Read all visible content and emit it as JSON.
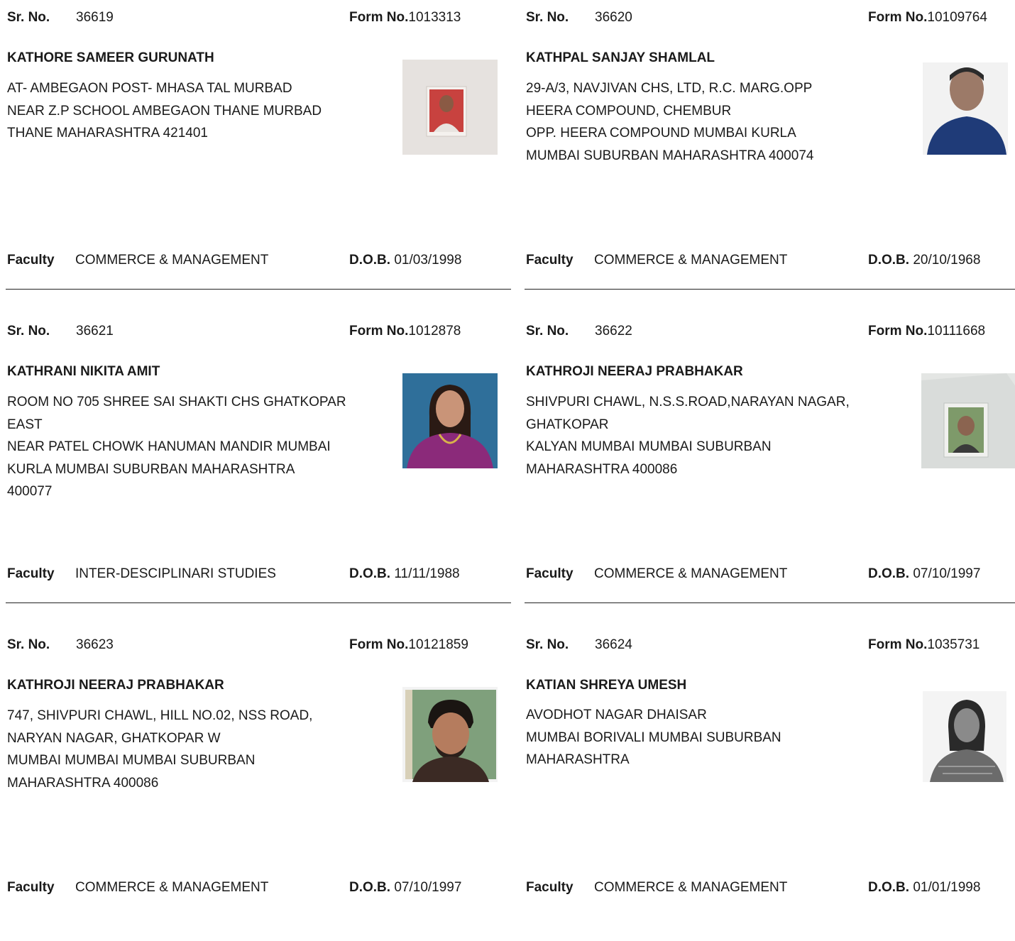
{
  "labels": {
    "sr_no": "Sr. No.",
    "form_no": "Form No.",
    "faculty": "Faculty",
    "dob": "D.O.B."
  },
  "records": [
    {
      "sr_no": "36619",
      "form_no": "1013313",
      "name": "KATHORE SAMEER GURUNATH",
      "address": [
        "AT- AMBEGAON POST- MHASA TAL MURBAD",
        "NEAR Z.P SCHOOL AMBEGAON THANE MURBAD",
        "THANE MAHARASHTRA 421401"
      ],
      "faculty": "COMMERCE & MANAGEMENT",
      "dob": "01/03/1998"
    },
    {
      "sr_no": "36620",
      "form_no": "10109764",
      "name": "KATHPAL SANJAY SHAMLAL",
      "address": [
        "29-A/3, NAVJIVAN CHS, LTD, R.C. MARG.OPP",
        "HEERA COMPOUND, CHEMBUR",
        "OPP. HEERA COMPOUND MUMBAI KURLA",
        "MUMBAI SUBURBAN MAHARASHTRA 400074"
      ],
      "faculty": "COMMERCE & MANAGEMENT",
      "dob": "20/10/1968"
    },
    {
      "sr_no": "36621",
      "form_no": "1012878",
      "name": "KATHRANI NIKITA AMIT",
      "address": [
        "ROOM NO 705 SHREE SAI SHAKTI CHS GHATKOPAR",
        "EAST",
        "NEAR PATEL CHOWK HANUMAN MANDIR MUMBAI",
        "KURLA MUMBAI SUBURBAN MAHARASHTRA",
        "400077"
      ],
      "faculty": "INTER-DESCIPLINARI STUDIES",
      "dob": "11/11/1988"
    },
    {
      "sr_no": "36622",
      "form_no": "10111668",
      "name": "KATHROJI NEERAJ PRABHAKAR",
      "address": [
        "SHIVPURI CHAWL, N.S.S.ROAD,NARAYAN NAGAR,",
        "GHATKOPAR",
        " KALYAN MUMBAI MUMBAI SUBURBAN",
        "MAHARASHTRA 400086"
      ],
      "faculty": "COMMERCE & MANAGEMENT",
      "dob": "07/10/1997"
    },
    {
      "sr_no": "36623",
      "form_no": "10121859",
      "name": "KATHROJI NEERAJ PRABHAKAR",
      "address": [
        "747, SHIVPURI CHAWL, HILL NO.02, NSS ROAD,",
        "NARYAN NAGAR, GHATKOPAR W",
        " MUMBAI MUMBAI MUMBAI SUBURBAN",
        "MAHARASHTRA 400086"
      ],
      "faculty": "COMMERCE & MANAGEMENT",
      "dob": "07/10/1997"
    },
    {
      "sr_no": "36624",
      "form_no": "1035731",
      "name": "KATIAN SHREYA UMESH",
      "address": [
        "AVODHOT NAGAR DHAISAR",
        " MUMBAI BORIVALI MUMBAI SUBURBAN",
        "MAHARASHTRA"
      ],
      "faculty": "COMMERCE & MANAGEMENT",
      "dob": "01/01/1998"
    }
  ]
}
